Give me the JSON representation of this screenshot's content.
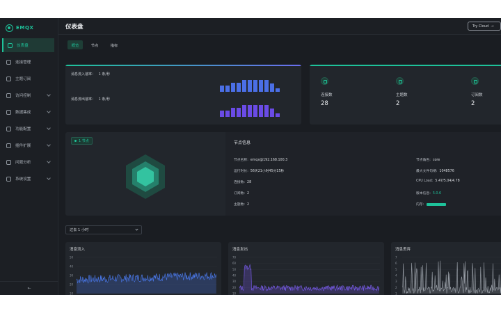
{
  "app": {
    "logo_text": "EMQX",
    "page_title": "仪表盘",
    "try_cloud": "Try Cloud",
    "footer_toggle": "⇤"
  },
  "sidebar": {
    "items": [
      {
        "label": "仪表盘",
        "active": true,
        "chevron": false
      },
      {
        "label": "连接管理",
        "active": false,
        "chevron": false
      },
      {
        "label": "主题订阅",
        "active": false,
        "chevron": false
      },
      {
        "label": "访问控制",
        "active": false,
        "chevron": true
      },
      {
        "label": "数据集成",
        "active": false,
        "chevron": true
      },
      {
        "label": "功能配置",
        "active": false,
        "chevron": true
      },
      {
        "label": "插件扩展",
        "active": false,
        "chevron": true
      },
      {
        "label": "问题分析",
        "active": false,
        "chevron": true
      },
      {
        "label": "系统设置",
        "active": false,
        "chevron": true
      }
    ]
  },
  "tabs": [
    {
      "label": "概览",
      "active": true
    },
    {
      "label": "节点",
      "active": false
    },
    {
      "label": "指标",
      "active": false
    }
  ],
  "rates": {
    "in_label": "消息流入速率：",
    "in_value": "1 条/秒",
    "out_label": "消息流出速率：",
    "out_value": "1 条/秒",
    "in_bars": [
      0.55,
      0.55,
      0.78,
      0.78,
      1.0,
      1.0,
      1.0,
      1.0,
      1.0,
      0.72,
      0.3
    ],
    "out_bars": [
      0.55,
      0.55,
      0.78,
      0.78,
      1.0,
      1.0,
      1.0,
      1.0,
      1.0,
      0.72,
      0.3
    ],
    "in_color": "#4b6fe6",
    "out_color": "#6a4be6"
  },
  "metrics": [
    {
      "label": "连接数",
      "value": "28",
      "icon": "link-icon"
    },
    {
      "label": "主题数",
      "value": "2",
      "icon": "hash-icon"
    },
    {
      "label": "订阅数",
      "value": "2",
      "icon": "subscribe-icon"
    }
  ],
  "node": {
    "badge": "1 节点",
    "info_title": "节点信息",
    "left": [
      {
        "k": "节点名称:",
        "v": "emqx@192.168.100.3"
      },
      {
        "k": "运行时长:",
        "v": "56天21小时45分15秒"
      },
      {
        "k": "连接数:",
        "v": "28"
      },
      {
        "k": "订阅数:",
        "v": "2"
      },
      {
        "k": "主题数:",
        "v": "2"
      }
    ],
    "right": [
      {
        "k": "节点角色:",
        "v": "core"
      },
      {
        "k": "最大文件句柄:",
        "v": "1048576"
      },
      {
        "k": "CPU Load:",
        "v": "5.47/5.04/4.78"
      },
      {
        "k": "版本信息:",
        "v": "5.0.6"
      },
      {
        "k": "内存:",
        "v": ""
      }
    ],
    "memory_used": 0.75
  },
  "range_select": {
    "value": "过去 1 小时"
  },
  "charts": [
    {
      "title": "消息流入",
      "yticks": [
        "50",
        "40",
        "30",
        "20",
        "10"
      ],
      "color": "#4b7bf0"
    },
    {
      "title": "消息发出",
      "yticks": [
        "70",
        "60",
        "50",
        "40",
        "30",
        "20",
        "10"
      ],
      "color": "#7a5cf0"
    },
    {
      "title": "消息丢弃",
      "yticks": [
        "7",
        "6",
        "5",
        "4",
        "3",
        "2",
        "1"
      ],
      "color": "#9aa0a8"
    }
  ],
  "colors": {
    "accent": "#1ec29a",
    "bg": "#1a1d22",
    "card": "#22262c"
  }
}
